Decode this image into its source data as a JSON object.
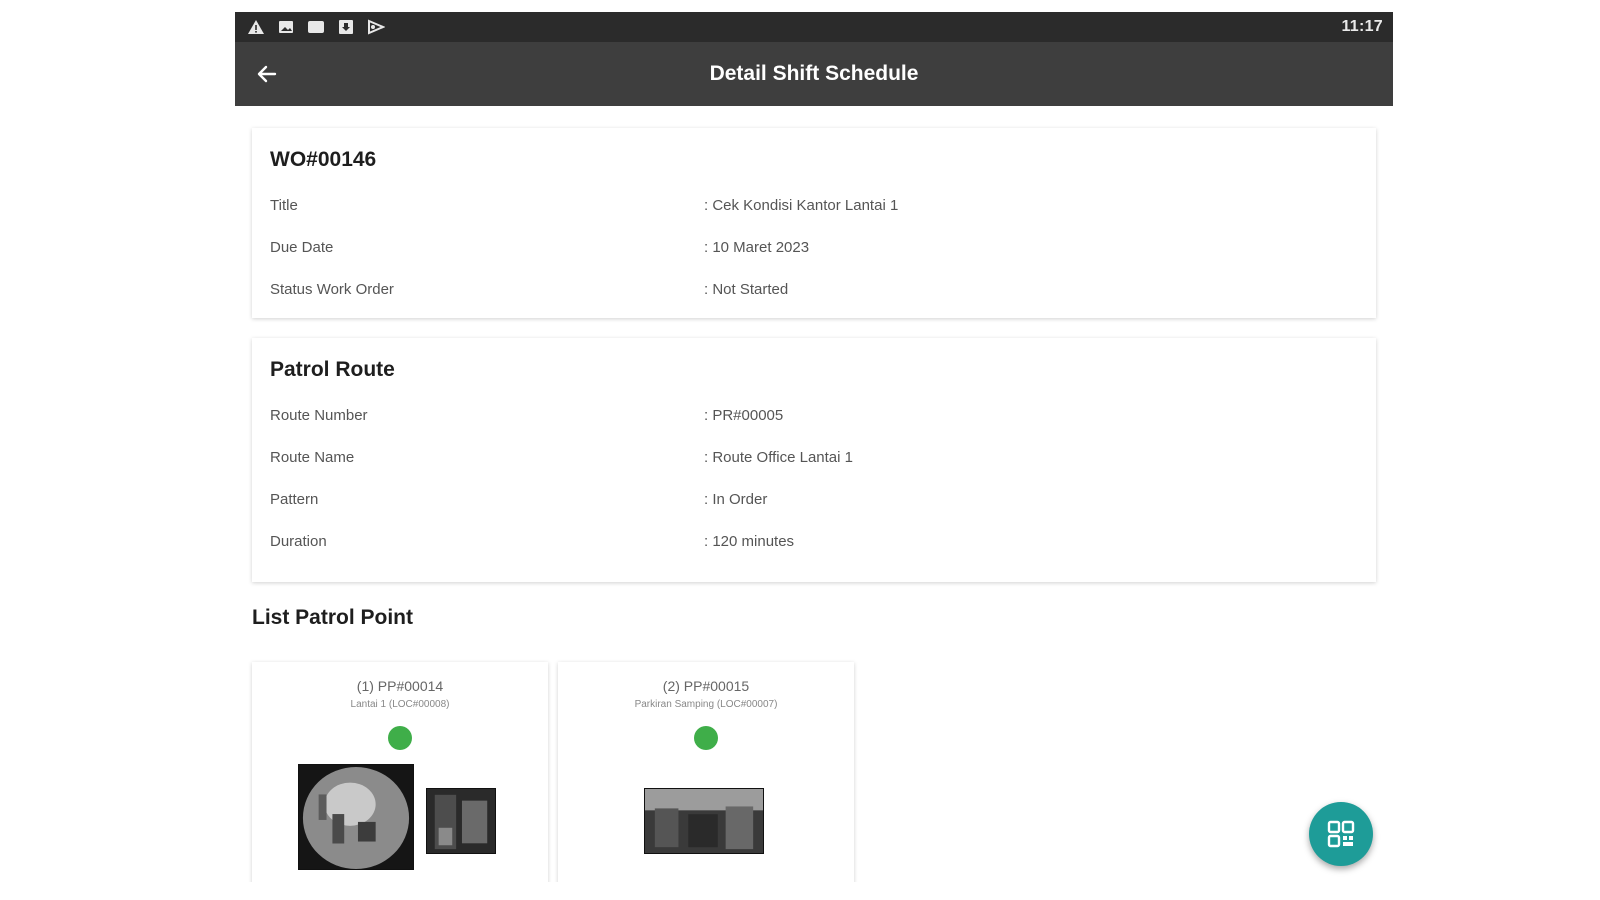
{
  "status_bar": {
    "time": "11:17",
    "icons": [
      "warning-icon",
      "image-icon",
      "message-icon",
      "download-icon",
      "cast-icon"
    ]
  },
  "app_bar": {
    "back_icon": "arrow-left-icon",
    "title": "Detail Shift Schedule"
  },
  "work_order": {
    "title": "WO#00146",
    "rows": [
      {
        "label": "Title",
        "value": ": Cek Kondisi Kantor Lantai 1"
      },
      {
        "label": "Due Date",
        "value": ": 10 Maret 2023"
      },
      {
        "label": "Status Work Order",
        "value": ": Not Started"
      }
    ]
  },
  "patrol_route": {
    "title": "Patrol Route",
    "rows": [
      {
        "label": "Route Number",
        "value": ": PR#00005"
      },
      {
        "label": "Route Name",
        "value": ": Route Office Lantai 1"
      },
      {
        "label": "Pattern",
        "value": ": In Order"
      },
      {
        "label": "Duration",
        "value": ": 120 minutes"
      }
    ]
  },
  "patrol_points": {
    "title": "List Patrol Point",
    "status_color": "#3fae49",
    "items": [
      {
        "code": "(1) PP#00014",
        "location": "Lantai 1 (LOC#00008)",
        "photo_count": 2
      },
      {
        "code": "(2) PP#00015",
        "location": "Parkiran Samping (LOC#00007)",
        "photo_count": 1
      }
    ]
  },
  "fab": {
    "icon": "qr-code-icon",
    "color": "#1e9c98"
  }
}
